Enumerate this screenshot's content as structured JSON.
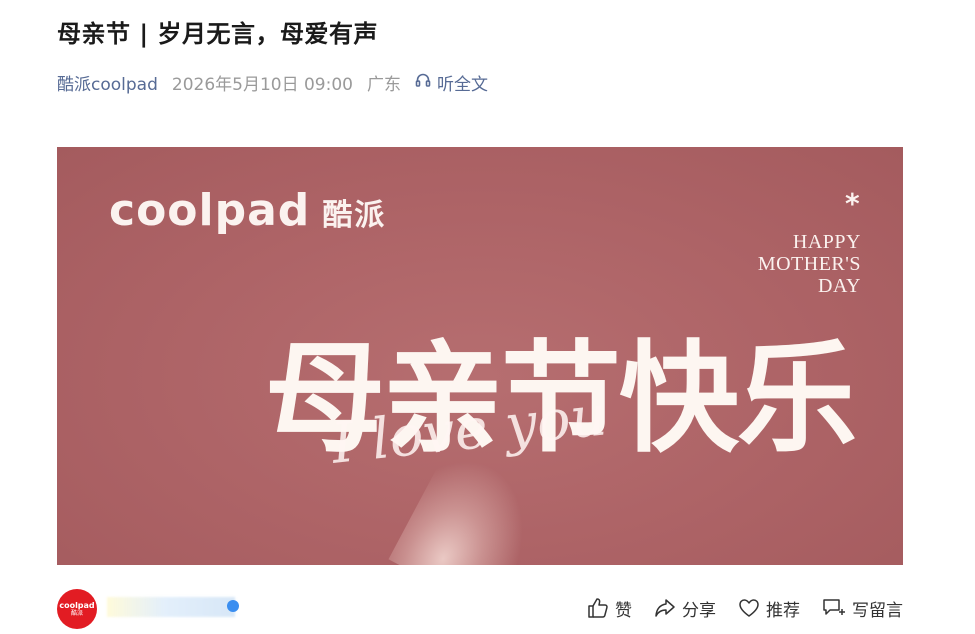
{
  "article": {
    "title": "母亲节 | 岁月无言，母爱有声",
    "author": "酷派coolpad",
    "time": "2026年5月10日 09:00",
    "location": "广东",
    "listen_label": "听全文"
  },
  "banner": {
    "brand_en": "coolpad",
    "brand_cn": "酷派",
    "asterisk": "*",
    "happy_line1": "HAPPY",
    "happy_line2": "MOTHER'S",
    "happy_line3": "DAY",
    "headline": "母亲节快乐",
    "script": "I love you",
    "bg_color": "#ad6366"
  },
  "footer": {
    "avatar_line1": "coolpad",
    "avatar_line2": "酷派",
    "actions": [
      {
        "label": "赞",
        "icon": "thumbs-up-icon"
      },
      {
        "label": "分享",
        "icon": "share-icon"
      },
      {
        "label": "推荐",
        "icon": "heart-icon"
      },
      {
        "label": "写留言",
        "icon": "comment-icon"
      }
    ]
  }
}
